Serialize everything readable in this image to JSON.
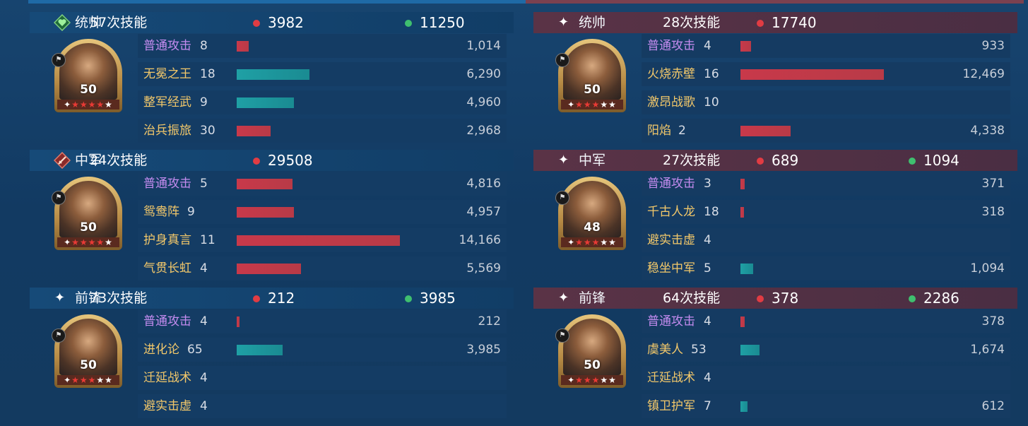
{
  "left": {
    "sections": [
      {
        "position": "统帅",
        "icon": "heart-badge-icon",
        "count": "57次技能",
        "damage": "3982",
        "heal": "11250",
        "level": "50",
        "stars": 5,
        "red_stars": 4,
        "skills": [
          {
            "name": "普通攻击",
            "normal": true,
            "count": "8",
            "value": "1,014",
            "value_num": 1014,
            "color": "red"
          },
          {
            "name": "无冕之王",
            "count": "18",
            "value": "6,290",
            "value_num": 6290,
            "color": "teal"
          },
          {
            "name": "整军经武",
            "count": "9",
            "value": "4,960",
            "value_num": 4960,
            "color": "teal"
          },
          {
            "name": "治兵振旅",
            "count": "30",
            "value": "2,968",
            "value_num": 2968,
            "color": "red"
          }
        ]
      },
      {
        "position": "中军",
        "icon": "sword-badge-icon",
        "count": "24次技能",
        "damage": "29508",
        "heal": "",
        "level": "50",
        "stars": 5,
        "red_stars": 4,
        "skills": [
          {
            "name": "普通攻击",
            "normal": true,
            "count": "5",
            "value": "4,816",
            "value_num": 4816,
            "color": "red"
          },
          {
            "name": "鸳鸯阵",
            "count": "9",
            "value": "4,957",
            "value_num": 4957,
            "color": "red"
          },
          {
            "name": "护身真言",
            "count": "11",
            "value": "14,166",
            "value_num": 14166,
            "color": "red"
          },
          {
            "name": "气贯长虹",
            "count": "4",
            "value": "5,569",
            "value_num": 5569,
            "color": "red"
          }
        ]
      },
      {
        "position": "前锋",
        "icon": "spark-icon",
        "count": "73次技能",
        "damage": "212",
        "heal": "3985",
        "level": "50",
        "stars": 5,
        "red_stars": 3,
        "skills": [
          {
            "name": "普通攻击",
            "normal": true,
            "count": "4",
            "value": "212",
            "value_num": 212,
            "color": "red"
          },
          {
            "name": "进化论",
            "count": "65",
            "value": "3,985",
            "value_num": 3985,
            "color": "teal"
          },
          {
            "name": "迁延战术",
            "count": "4",
            "value": "",
            "value_num": 0,
            "color": "red"
          },
          {
            "name": "避实击虚",
            "count": "4",
            "value": "",
            "value_num": 0,
            "color": "red"
          }
        ]
      }
    ]
  },
  "right": {
    "sections": [
      {
        "position": "统帅",
        "icon": "spark-icon",
        "count": "28次技能",
        "damage": "17740",
        "heal": "",
        "level": "50",
        "stars": 5,
        "red_stars": 3,
        "skills": [
          {
            "name": "普通攻击",
            "normal": true,
            "count": "4",
            "value": "933",
            "value_num": 933,
            "color": "red"
          },
          {
            "name": "火烧赤壁",
            "count": "16",
            "value": "12,469",
            "value_num": 12469,
            "color": "red"
          },
          {
            "name": "激昂战歌",
            "count": "10",
            "value": "",
            "value_num": 0,
            "color": "red"
          },
          {
            "name": "阳焰",
            "count": "2",
            "value": "4,338",
            "value_num": 4338,
            "color": "red"
          }
        ]
      },
      {
        "position": "中军",
        "icon": "spark-icon",
        "count": "27次技能",
        "damage": "689",
        "heal": "1094",
        "level": "48",
        "stars": 5,
        "red_stars": 3,
        "skills": [
          {
            "name": "普通攻击",
            "normal": true,
            "count": "3",
            "value": "371",
            "value_num": 371,
            "color": "red"
          },
          {
            "name": "千古人龙",
            "count": "18",
            "value": "318",
            "value_num": 318,
            "color": "red"
          },
          {
            "name": "避实击虚",
            "count": "4",
            "value": "",
            "value_num": 0,
            "color": "red"
          },
          {
            "name": "稳坐中军",
            "count": "5",
            "value": "1,094",
            "value_num": 1094,
            "color": "teal"
          }
        ]
      },
      {
        "position": "前锋",
        "icon": "spark-icon",
        "count": "64次技能",
        "damage": "378",
        "heal": "2286",
        "level": "50",
        "stars": 5,
        "red_stars": 3,
        "skills": [
          {
            "name": "普通攻击",
            "normal": true,
            "count": "4",
            "value": "378",
            "value_num": 378,
            "color": "red"
          },
          {
            "name": "虞美人",
            "count": "53",
            "value": "1,674",
            "value_num": 1674,
            "color": "teal"
          },
          {
            "name": "迁延战术",
            "count": "4",
            "value": "",
            "value_num": 0,
            "color": "red"
          },
          {
            "name": "镇卫护军",
            "count": "7",
            "value": "612",
            "value_num": 612,
            "color": "teal"
          }
        ]
      }
    ]
  }
}
